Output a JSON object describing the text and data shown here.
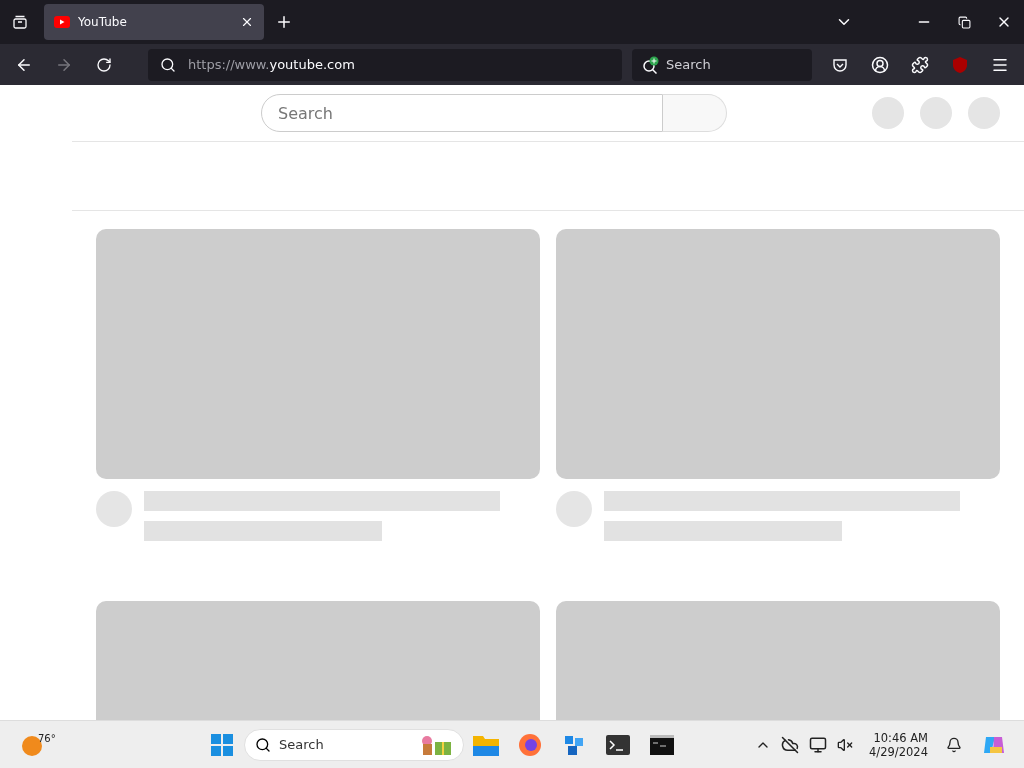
{
  "browser": {
    "tabs": [
      {
        "title": "YouTube",
        "selected": true
      }
    ],
    "url": {
      "prefix": "https://www.",
      "domain": "youtube.com"
    },
    "search": {
      "placeholder": "Search"
    }
  },
  "page": {
    "search": {
      "placeholder": "Search"
    },
    "cards": [
      {
        "kind": "video"
      },
      {
        "kind": "video"
      },
      {
        "kind": "thumbnail"
      },
      {
        "kind": "thumbnail"
      }
    ]
  },
  "taskbar": {
    "weather": "76°",
    "search": {
      "placeholder": "Search"
    },
    "time": "10:46 AM",
    "date": "4/29/2024"
  }
}
